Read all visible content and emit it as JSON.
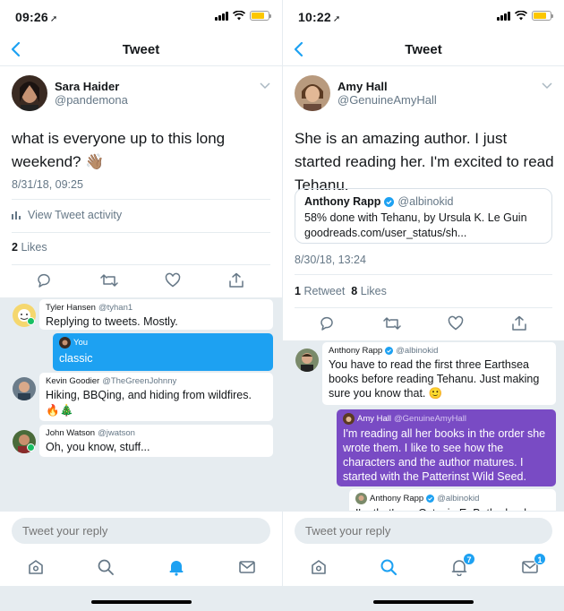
{
  "left": {
    "status": {
      "time": "09:26"
    },
    "nav": {
      "title": "Tweet"
    },
    "author": {
      "name": "Sara Haider",
      "handle": "@pandemona"
    },
    "tweet": {
      "text": "what is everyone up to this long weekend? 👋🏽",
      "date": "8/31/18, 09:25"
    },
    "activity_label": "View Tweet activity",
    "stats": {
      "likes_count": "2",
      "likes_label": "Likes"
    },
    "replies": [
      {
        "name": "Tyler Hansen",
        "handle": "@tyhan1",
        "text": "Replying to tweets. Mostly."
      },
      {
        "name": "You",
        "handle": "",
        "text": "classic"
      },
      {
        "name": "Kevin Goodier",
        "handle": "@TheGreenJohnny",
        "text": "Hiking, BBQing, and hiding from wildfires.",
        "extra": "🔥🎄"
      },
      {
        "name": "John Watson",
        "handle": "@jwatson",
        "text": "Oh, you know, stuff..."
      }
    ],
    "composer": {
      "placeholder": "Tweet your reply"
    }
  },
  "right": {
    "status": {
      "time": "10:22"
    },
    "nav": {
      "title": "Tweet"
    },
    "author": {
      "name": "Amy Hall",
      "handle": "@GenuineAmyHall"
    },
    "tweet": {
      "text": "She is an amazing author. I just started reading her.  I'm excited to read Tehanu.",
      "date": "8/30/18, 13:24"
    },
    "quote": {
      "name": "Anthony Rapp",
      "handle": "@albinokid",
      "line1": "58% done with Tehanu, by Ursula K. Le Guin",
      "line2": "goodreads.com/user_status/sh..."
    },
    "stats": {
      "retweets_count": "1",
      "retweets_label": "Retweet",
      "likes_count": "8",
      "likes_label": "Likes"
    },
    "replies": [
      {
        "name": "Anthony Rapp",
        "handle": "@albinokid",
        "text": "You have to read the first three Earthsea books before reading Tehanu. Just making sure you know that. 🙂"
      },
      {
        "name": "Amy Hall",
        "handle": "@GenuineAmyHall",
        "text": "I'm reading all her books in the order she wrote them.  I like to see how the characters and the author matures.  I started with the Patterinst Wild Seed."
      },
      {
        "name": "Anthony Rapp",
        "handle": "@albinokid",
        "text": "I'm that's an Octavia E. Butler book"
      }
    ],
    "composer": {
      "placeholder": "Tweet your reply"
    },
    "badges": {
      "notifications": "7",
      "messages": "1"
    }
  },
  "icons": {
    "back": "chevron-left-icon",
    "caret": "chevron-down-icon",
    "reply": "reply-icon",
    "retweet": "retweet-icon",
    "like": "heart-icon",
    "share": "share-icon",
    "home": "home-icon",
    "search": "search-icon",
    "notifications": "bell-icon",
    "messages": "envelope-icon"
  },
  "colors": {
    "accent": "#1da1f2",
    "purple": "#794bc4",
    "muted": "#657786",
    "divider": "#e6ecf0"
  }
}
